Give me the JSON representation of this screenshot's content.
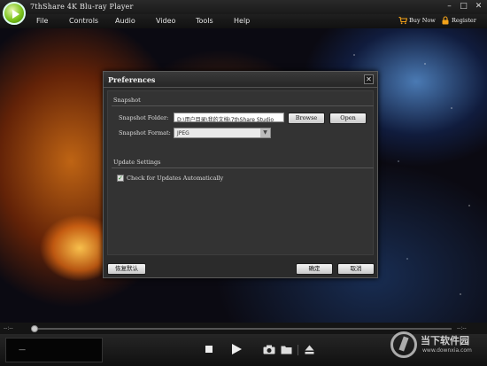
{
  "app": {
    "title": "7thShare 4K Blu-ray Player",
    "buy_now": "Buy Now",
    "register": "Register"
  },
  "menu": {
    "items": [
      "File",
      "Controls",
      "Audio",
      "Video",
      "Tools",
      "Help"
    ]
  },
  "player": {
    "time_elapsed": "--:--",
    "time_total": "--:--",
    "status_text": "—"
  },
  "dialog": {
    "title": "Preferences",
    "snapshot_section": "Snapshot",
    "snapshot_folder_label": "Snapshot Folder:",
    "snapshot_folder_value": "D:\\用户目录\\我的文档\\7thShare Studio",
    "browse_label": "Browse",
    "open_label": "Open",
    "snapshot_format_label": "Snapshot Format:",
    "snapshot_format_value": "JPEG",
    "update_section": "Update Settings",
    "check_updates_label": "Check for Updates Automatically",
    "check_updates_checked": true,
    "reset_label": "恢复默认",
    "ok_label": "确定",
    "cancel_label": "取消"
  },
  "watermark": {
    "text": "当下软件园",
    "sub": "www.downxia.com"
  }
}
